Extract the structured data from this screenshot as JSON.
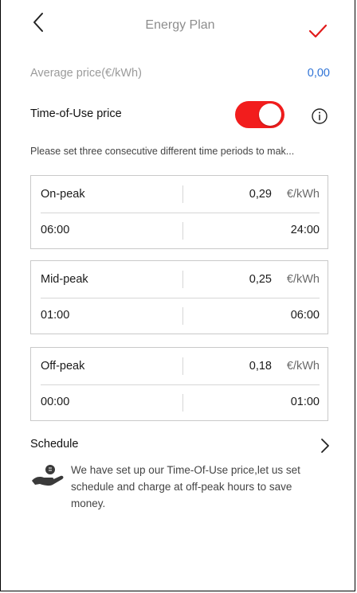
{
  "header": {
    "title": "Energy Plan"
  },
  "average": {
    "label": "Average price(€/kWh)",
    "value": "0,00"
  },
  "tou": {
    "label": "Time-of-Use price",
    "enabled": true
  },
  "hint": "Please set three consecutive different time periods to mak...",
  "periods": [
    {
      "name": "On-peak",
      "price": "0,29",
      "unit": "€/kWh",
      "start": "06:00",
      "end": "24:00"
    },
    {
      "name": "Mid-peak",
      "price": "0,25",
      "unit": "€/kWh",
      "start": "01:00",
      "end": "06:00"
    },
    {
      "name": "Off-peak",
      "price": "0,18",
      "unit": "€/kWh",
      "start": "00:00",
      "end": "01:00"
    }
  ],
  "schedule": {
    "label": "Schedule",
    "tip": "We have set up our Time-Of-Use price,let us set schedule and charge at off-peak hours to save money."
  },
  "colors": {
    "accent": "#f21d1d",
    "link": "#2f73d6"
  }
}
